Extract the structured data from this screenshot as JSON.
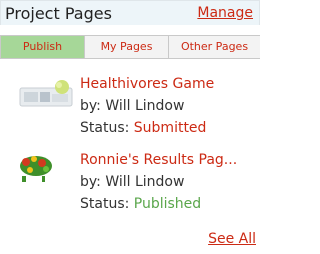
{
  "panel": {
    "title": "Project Pages",
    "manage_label": "Manage"
  },
  "tabs": [
    {
      "label": "Publish",
      "active": true
    },
    {
      "label": "My Pages",
      "active": false
    },
    {
      "label": "Other Pages",
      "active": false
    }
  ],
  "items": [
    {
      "name": "Healthivores Game",
      "author_label": "by:",
      "author": "Will Lindow",
      "status_label": "Status:",
      "status": "Submitted",
      "status_color": "#cc2a14",
      "thumb_icon": "game-thumbnail"
    },
    {
      "name": "Ronnie's Results Pag...",
      "author_label": "by:",
      "author": "Will Lindow",
      "status_label": "Status:",
      "status": "Published",
      "status_color": "#5aa64b",
      "thumb_icon": "results-thumbnail"
    }
  ],
  "footer": {
    "see_all_label": "See All"
  },
  "colors": {
    "accent": "#cc2a14",
    "tab_active_bg": "#a6d798",
    "header_bg": "#edf5f9"
  }
}
